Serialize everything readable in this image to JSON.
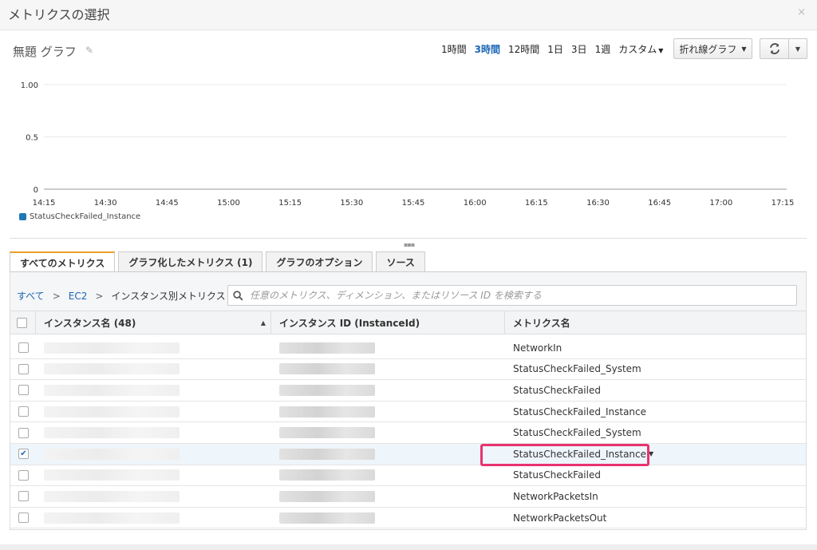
{
  "modal": {
    "title": "メトリクスの選択",
    "close": "×"
  },
  "graph": {
    "title": "無題 グラフ",
    "edit_icon": "pencil-icon"
  },
  "time_ranges": [
    {
      "label": "1時間",
      "active": false
    },
    {
      "label": "3時間",
      "active": true
    },
    {
      "label": "12時間",
      "active": false
    },
    {
      "label": "1日",
      "active": false
    },
    {
      "label": "3日",
      "active": false
    },
    {
      "label": "1週",
      "active": false
    },
    {
      "label": "カスタム",
      "active": false,
      "dropdown": true
    }
  ],
  "chart_type": {
    "label": "折れ線グラフ"
  },
  "refresh": {
    "icon": "refresh-icon"
  },
  "chart_data": {
    "type": "line",
    "y_ticks": [
      "1.00",
      "0.5",
      "0"
    ],
    "ylim": [
      0,
      1
    ],
    "x_ticks": [
      "14:15",
      "14:30",
      "14:45",
      "15:00",
      "15:15",
      "15:30",
      "15:45",
      "16:00",
      "16:15",
      "16:30",
      "16:45",
      "17:00",
      "17:15"
    ],
    "grid": true,
    "legend_position": "bottom-left",
    "series": [
      {
        "name": "StatusCheckFailed_Instance",
        "color": "#1f77b4",
        "values": []
      }
    ]
  },
  "tabs": [
    {
      "label": "すべてのメトリクス",
      "active": true
    },
    {
      "label": "グラフ化したメトリクス (1)",
      "active": false
    },
    {
      "label": "グラフのオプション",
      "active": false
    },
    {
      "label": "ソース",
      "active": false
    }
  ],
  "breadcrumb": {
    "all": "すべて",
    "ec2": "EC2",
    "current": "インスタンス別メトリクス",
    "sep": ">"
  },
  "search": {
    "placeholder": "任意のメトリクス、ディメンション、またはリソース ID を検索する"
  },
  "table": {
    "columns": [
      "インスタンス名 (48)",
      "インスタンス ID (InstanceId)",
      "メトリクス名"
    ],
    "rows": [
      {
        "metric": "NetworkIn",
        "checked": false
      },
      {
        "metric": "StatusCheckFailed_System",
        "checked": false
      },
      {
        "metric": "StatusCheckFailed",
        "checked": false
      },
      {
        "metric": "StatusCheckFailed_Instance",
        "checked": false
      },
      {
        "metric": "StatusCheckFailed_System",
        "checked": false
      },
      {
        "metric": "StatusCheckFailed_Instance",
        "checked": true,
        "dropdown": true
      },
      {
        "metric": "StatusCheckFailed",
        "checked": false
      },
      {
        "metric": "NetworkPacketsIn",
        "checked": false
      },
      {
        "metric": "NetworkPacketsOut",
        "checked": false
      }
    ]
  }
}
